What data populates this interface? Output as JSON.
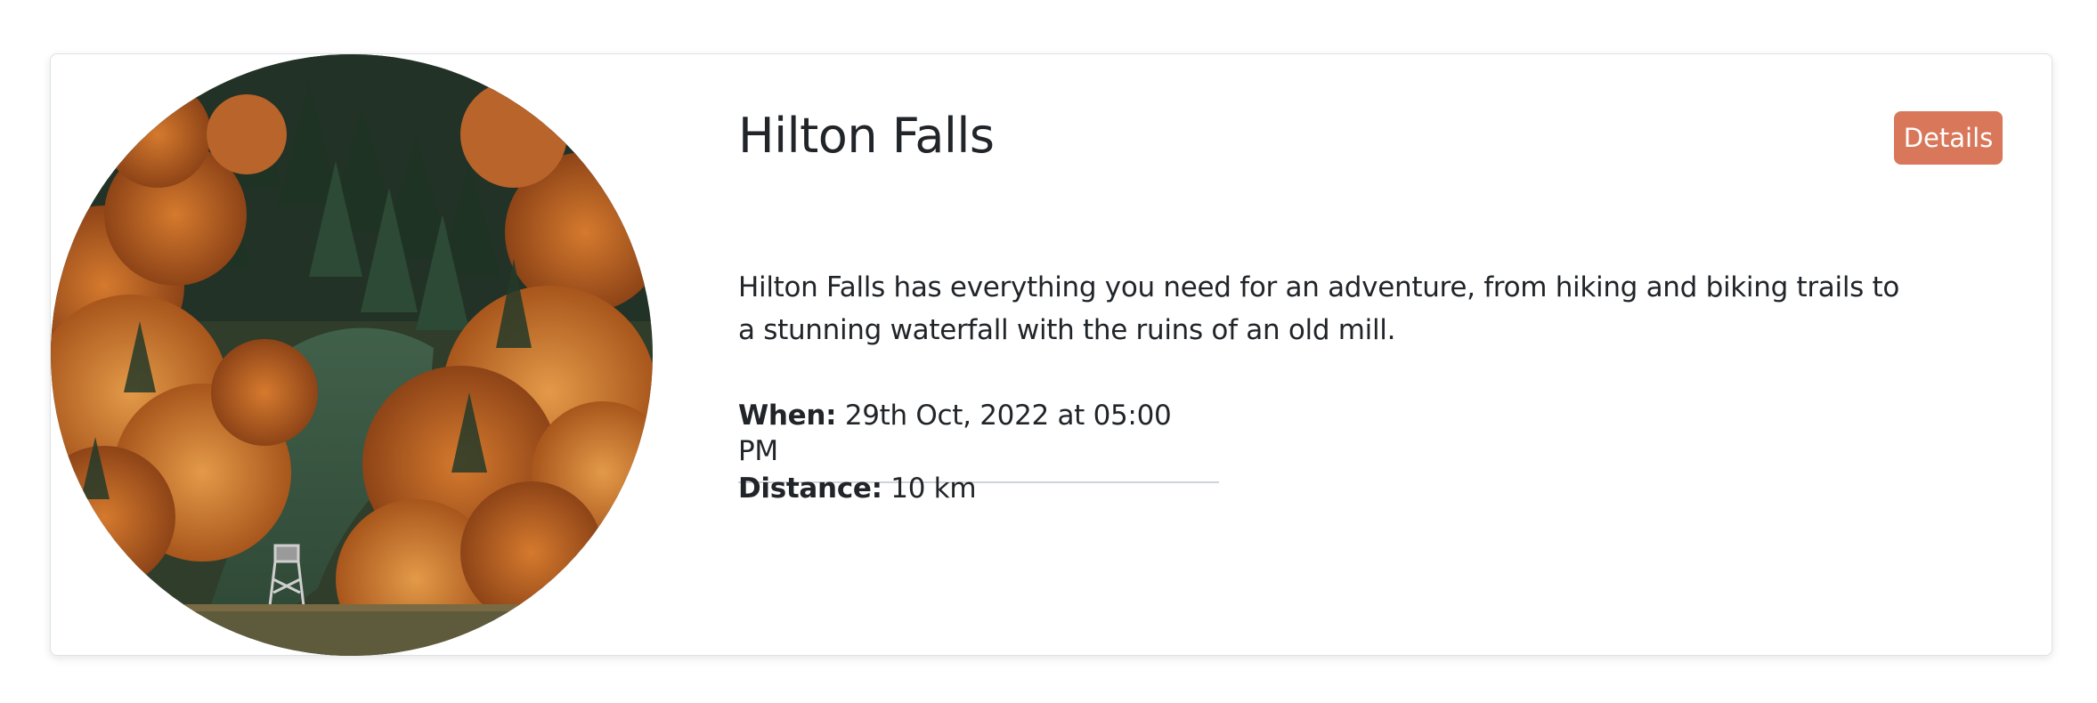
{
  "event": {
    "title": "Hilton Falls",
    "description": "Hilton Falls has everything you need for an adventure, from hiking and biking trails to a stunning waterfall with the ruins of an old mill.",
    "details_button": "Details",
    "when_label": "When:",
    "when_value": " 29th Oct, 2022 at 05:00 PM",
    "distance_label": "Distance:",
    "distance_value": " 10 km"
  },
  "colors": {
    "accent": "#d9775a",
    "text": "#212529",
    "divider": "#d0d4d8"
  }
}
